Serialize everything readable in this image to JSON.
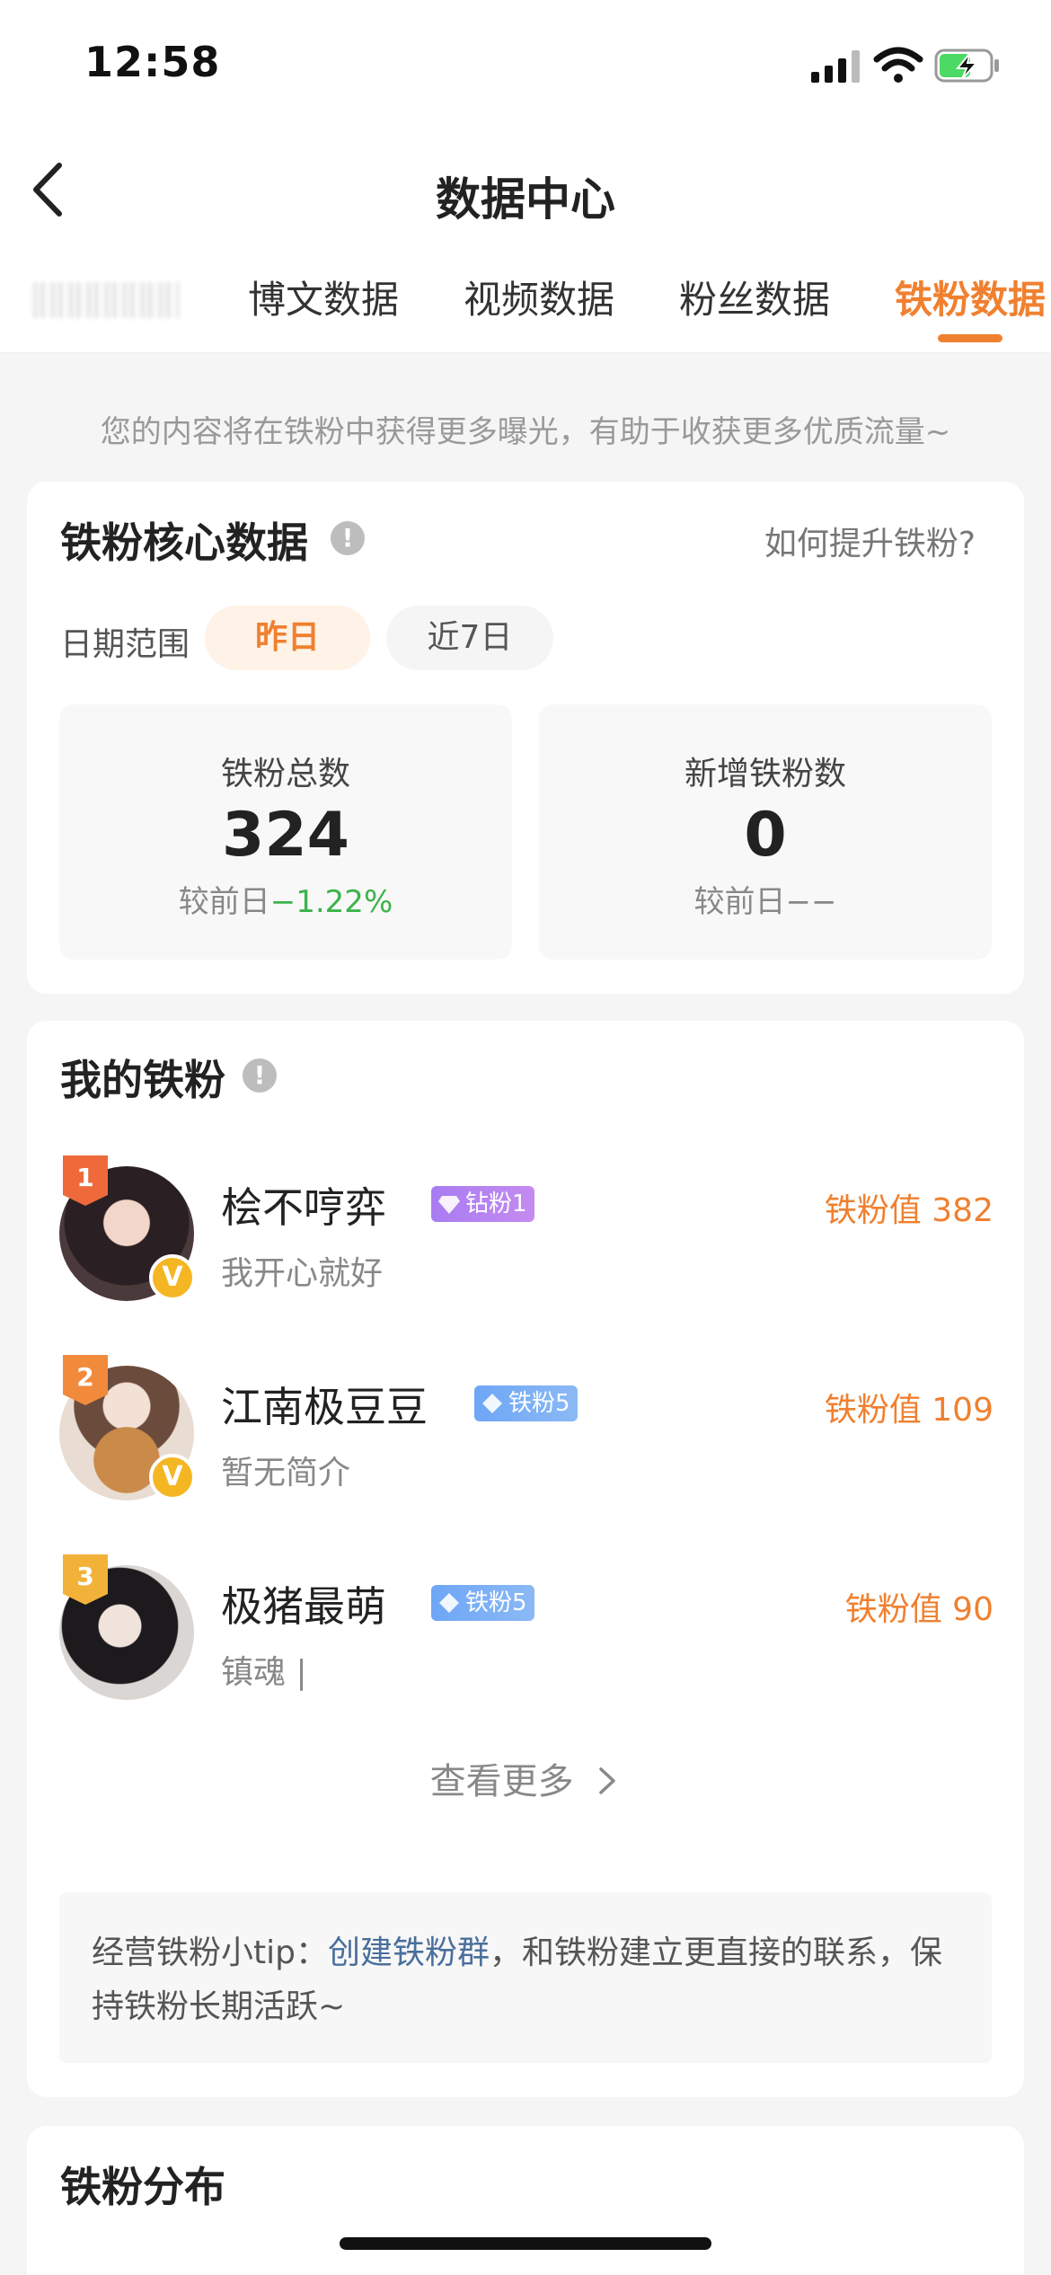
{
  "status": {
    "time": "12:58"
  },
  "nav": {
    "title": "数据中心"
  },
  "tabs": [
    {
      "label": "博文数据"
    },
    {
      "label": "视频数据"
    },
    {
      "label": "粉丝数据"
    },
    {
      "label": "铁粉数据",
      "active": true
    }
  ],
  "hint": "您的内容将在铁粉中获得更多曝光，有助于收获更多优质流量~",
  "core": {
    "title": "铁粉核心数据",
    "help": "如何提升铁粉?",
    "range_label": "日期范围",
    "range_options": [
      "昨日",
      "近7日"
    ],
    "selected_range": "昨日",
    "stats": [
      {
        "label": "铁粉总数",
        "value": "324",
        "compare_prefix": "较前日",
        "compare_value": "−1.22%"
      },
      {
        "label": "新增铁粉数",
        "value": "0",
        "compare_prefix": "较前日",
        "compare_value": "−−"
      }
    ]
  },
  "my_fans": {
    "title": "我的铁粉",
    "list": [
      {
        "rank": "1",
        "name": "桧不哼弈",
        "badge": "钻粉1",
        "bio": "我开心就好",
        "score": "铁粉值 382",
        "verified": true
      },
      {
        "rank": "2",
        "name": "江南极豆豆",
        "badge": "铁粉5",
        "bio": "暂无简介",
        "score": "铁粉值 109",
        "verified": true
      },
      {
        "rank": "3",
        "name": "极猪最萌",
        "badge": "铁粉5",
        "bio": "镇魂 |",
        "score": "铁粉值 90",
        "verified": false
      }
    ],
    "more": "查看更多",
    "tip_prefix": "经营铁粉小tip：",
    "tip_link": "创建铁粉群",
    "tip_suffix": "，和铁粉建立更直接的联系，保持铁粉长期活跃~"
  },
  "distribution": {
    "title": "铁粉分布"
  },
  "colors": {
    "accent": "#f0802f",
    "green": "#3cb34b",
    "link": "#4a6f9c"
  }
}
